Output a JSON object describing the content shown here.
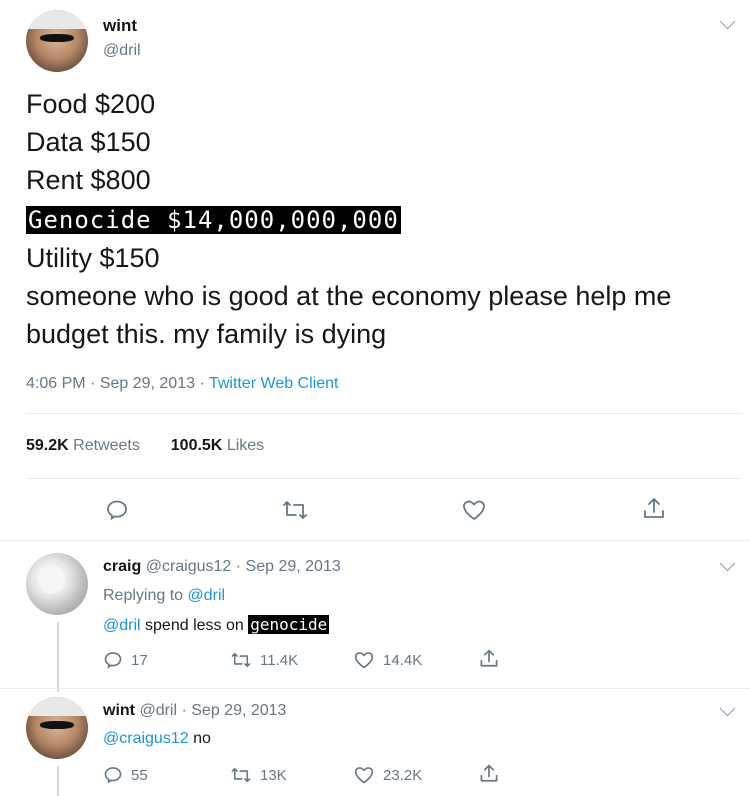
{
  "tweet": {
    "author_name": "wint",
    "author_handle": "@dril",
    "lines": [
      "Food $200",
      "Data $150",
      "Rent $800",
      "Genocide $14,000,000,000",
      "Utility $150",
      "someone who is good at the economy please help me",
      "budget this. my family is dying"
    ],
    "time": "4:06 PM · Sep 29, 2013 · ",
    "client": "Twitter Web Client",
    "retweets_count": "59.2K",
    "retweets_label": "Retweets",
    "likes_count": "100.5K",
    "likes_label": "Likes"
  },
  "replies": [
    {
      "author_name": "craig",
      "meta": "@craigus12 · Sep 29, 2013",
      "replying_prefix": "Replying to ",
      "replying_to": "@dril",
      "mention": "@dril",
      "text_plain": " spend less on ",
      "text_redacted": "genocide",
      "reply_count": "17",
      "retweet_count": "11.4K",
      "like_count": "14.4K"
    },
    {
      "author_name": "wint",
      "meta": "@dril · Sep 29, 2013",
      "mention": "@craigus12",
      "text_plain": " no",
      "reply_count": "55",
      "retweet_count": "13K",
      "like_count": "23.2K"
    }
  ],
  "icons": [
    "reply-icon",
    "retweet-icon",
    "like-icon",
    "share-icon",
    "chevron-down-icon"
  ],
  "colors": {
    "link": "#1b95e0",
    "muted": "#657786",
    "text": "#14171a",
    "redaction": "#000000"
  }
}
